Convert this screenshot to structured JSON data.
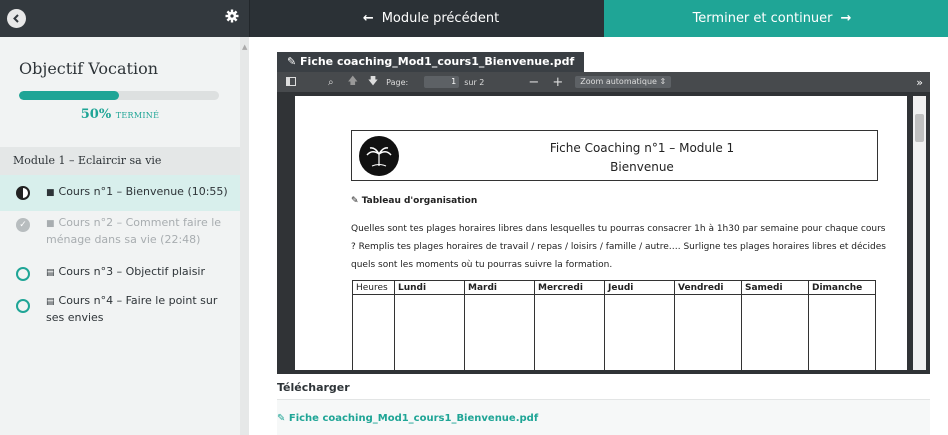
{
  "topbar": {
    "close_glyph": "×",
    "previous_label": "Module précédent",
    "next_label": "Terminer et continuer"
  },
  "sidebar": {
    "title": "Objectif Vocation",
    "progress_percent": 50,
    "progress_text": "50%",
    "progress_status": "TERMINÉ",
    "module_title": "Module 1 – Eclaircir sa vie",
    "lessons": [
      {
        "label": "Cours n°1 – Bienvenue (10:55)",
        "icon": "video-icon",
        "status": "in-progress"
      },
      {
        "label": "Cours n°2 – Comment faire le ménage dans sa vie (22:48)",
        "icon": "video-icon",
        "status": "completed"
      },
      {
        "label": "Cours n°3 – Objectif plaisir",
        "icon": "document-icon",
        "status": "not-started"
      },
      {
        "label": "Cours n°4 – Faire le point sur ses envies",
        "icon": "document-icon",
        "status": "not-started"
      }
    ]
  },
  "viewer": {
    "tab_label": "Fiche coaching_Mod1_cours1_Bienvenue.pdf",
    "toolbar": {
      "page_label": "Page:",
      "page_current": "1",
      "page_total": "sur 2",
      "zoom_label": "Zoom automatique"
    },
    "document": {
      "title_line1": "Fiche Coaching n°1 – Module 1",
      "title_line2": "Bienvenue",
      "section_title": "Tableau d'organisation",
      "paragraph": "Quelles sont tes plages horaires libres dans lesquelles tu pourras consacrer 1h à 1h30 par semaine pour chaque cours ? Remplis tes plages horaires de travail / repas / loisirs / famille / autre…. Surligne tes plages horaires libres et décides quels sont les moments où tu pourras suivre la formation.",
      "table_headers": [
        "Heures",
        "Lundi",
        "Mardi",
        "Mercredi",
        "Jeudi",
        "Vendredi",
        "Samedi",
        "Dimanche"
      ]
    }
  },
  "download": {
    "heading": "Télécharger",
    "link_label": "Fiche coaching_Mod1_cours1_Bienvenue.pdf"
  },
  "colors": {
    "accent": "#1fa596",
    "dark": "#33393e"
  }
}
